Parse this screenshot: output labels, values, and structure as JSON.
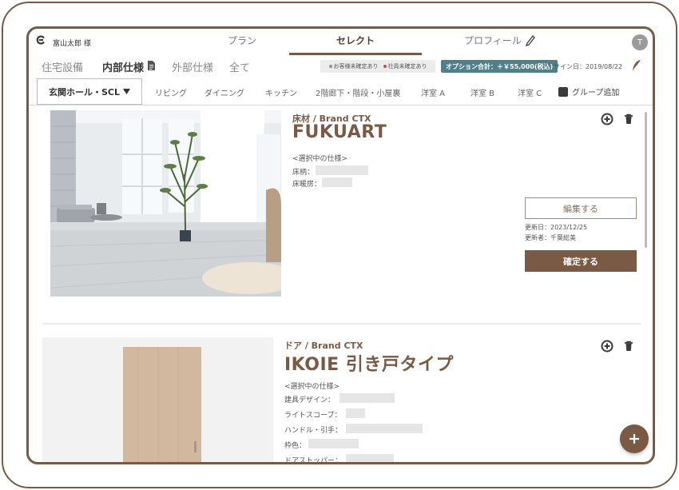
{
  "header": {
    "user_name": "富山太郎 様",
    "tabs": [
      {
        "label": "プラン",
        "active": false
      },
      {
        "label": "セレクト",
        "active": true
      },
      {
        "label": "プロフィール",
        "active": false
      }
    ],
    "avatar_initial": "T",
    "icons": {
      "logo": "brand-logo-icon",
      "profile_edit": "pencil-icon"
    }
  },
  "category_tabs": [
    {
      "label": "住宅設備",
      "active": false
    },
    {
      "label": "内部仕様",
      "active": true
    },
    {
      "label": "外部仕様",
      "active": false
    },
    {
      "label": "全て",
      "active": false
    }
  ],
  "legend": {
    "customer_label": "お客様未確定あり",
    "staff_label": "社員未確定あり",
    "customer_color": "#8a8fa8",
    "staff_color": "#c94a4a"
  },
  "option_total": "オプション合計：＋￥55,000(税込)",
  "sign_date": "サイン日：2019/08/22",
  "rooms": {
    "selected": "玄関ホール・SCL",
    "tabs": [
      "リビング",
      "ダイニング",
      "キッチン",
      "2階廊下・階段・小屋裏",
      "洋室 A",
      "洋室 B",
      "洋室 C"
    ],
    "group_add": "グループ追加"
  },
  "items": [
    {
      "category": "床材 / Brand  CTX",
      "title": "FUKUART",
      "spec_heading": "<選択中の仕様>",
      "specs": [
        "床柄：",
        "床暖房："
      ],
      "edit_label": "編集する",
      "updated_date": "更新日：2023/12/25",
      "updated_by": "更新者：千葉総美",
      "confirm_label": "確定する"
    },
    {
      "category": "ドア / Brand  CTX",
      "title": "IKOIE 引き戸タイプ",
      "spec_heading": "<選択中の仕様>",
      "specs": [
        "建具デザイン：",
        "ライトスコープ：",
        "ハンドル・引手：",
        "枠色：",
        "ドアストッパー："
      ]
    }
  ],
  "colors": {
    "brand": "#7a5a45",
    "option_badge": "#4f7f8a"
  }
}
